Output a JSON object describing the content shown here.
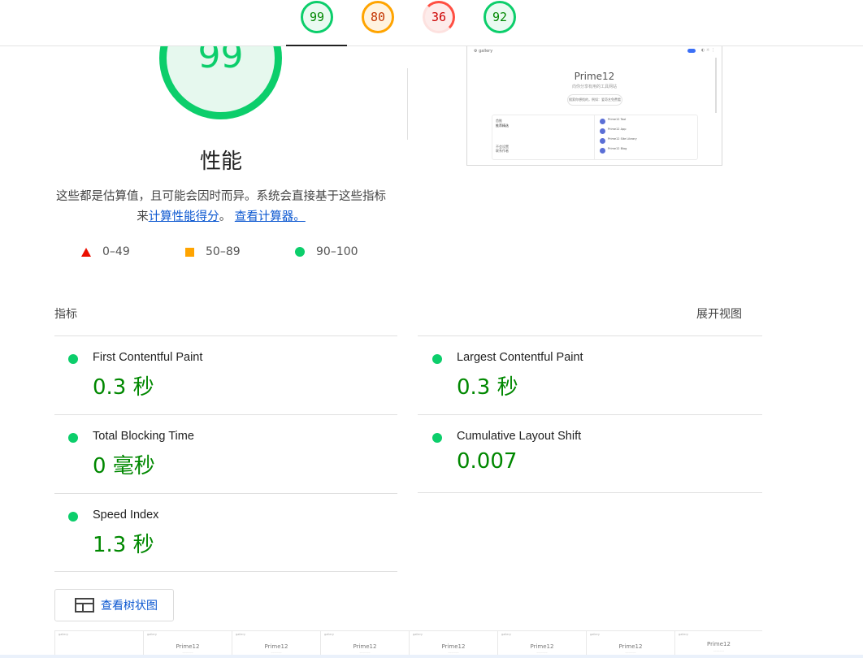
{
  "header": {
    "gauges": [
      {
        "score": "99",
        "status": "pass"
      },
      {
        "score": "80",
        "status": "average"
      },
      {
        "score": "36",
        "status": "fail"
      },
      {
        "score": "92",
        "status": "pass"
      }
    ]
  },
  "performance": {
    "score": "99",
    "title": "性能",
    "desc_prefix": "这些都是估算值，且可能会因时而异。系统会直接基于这些指标来",
    "link_calc_score": "计算性能得分",
    "desc_mid": "。 ",
    "link_view_calculator": "查看计算器。",
    "legend": [
      {
        "range": "0–49",
        "color": "#eb0f00"
      },
      {
        "range": "50–89",
        "color": "#ffa400"
      },
      {
        "range": "90–100",
        "color": "#0cce6b"
      }
    ]
  },
  "preview": {
    "brand": "gallery",
    "title": "Prime12",
    "subtitle": "向你分享有用的工具网站",
    "pill": "搜索你想找的，例如：爱奇艺免费看",
    "left_top_label": "首推",
    "left_top_text": "推荐精选",
    "left_bottom_label": "不会设置",
    "left_bottom_text": "联系作者",
    "rows": [
      "Prime12 Tool",
      "Prime12 App",
      "Prime12 Site Library",
      "Prime12 Blog"
    ]
  },
  "metrics": {
    "label": "指标",
    "expand_view": "展开视图",
    "items": [
      {
        "name": "First Contentful Paint",
        "value": "0.3 秒"
      },
      {
        "name": "Largest Contentful Paint",
        "value": "0.3 秒"
      },
      {
        "name": "Total Blocking Time",
        "value": "0 毫秒"
      },
      {
        "name": "Cumulative Layout Shift",
        "value": "0.007"
      },
      {
        "name": "Speed Index",
        "value": "1.3 秒"
      }
    ]
  },
  "tree_button": {
    "label": "查看树状图",
    "icon": "treemap-icon"
  },
  "filmstrip": {
    "frame_title": "Prime12",
    "frame_label": "gallery"
  },
  "colors": {
    "pass": "#0cce6b",
    "average": "#ffa400",
    "fail": "#ff4e42",
    "link": "#0b57d0",
    "metric_value": "#008800"
  }
}
